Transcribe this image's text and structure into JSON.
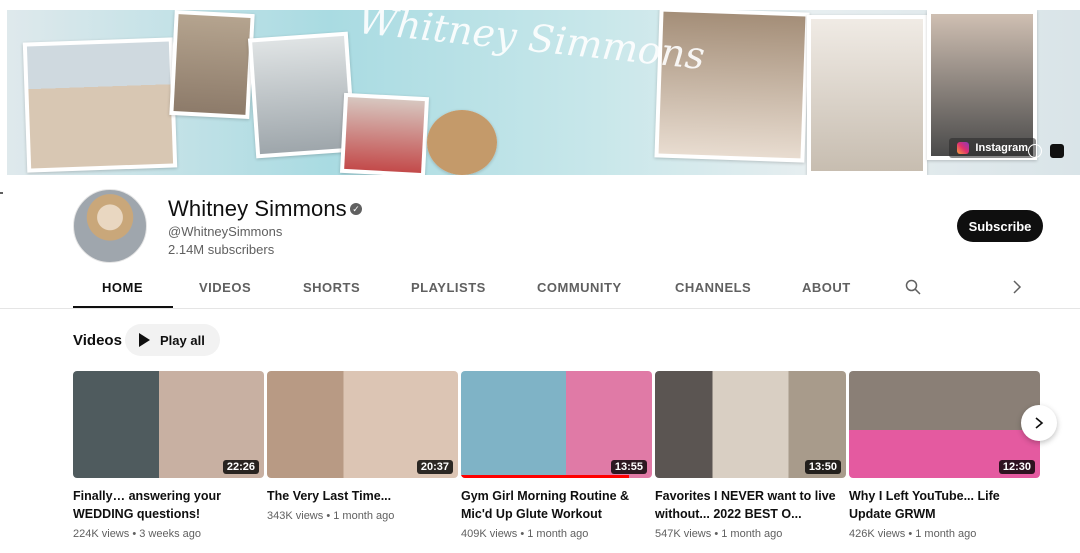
{
  "banner": {
    "script_text": "Whitney Simmons",
    "link_label": "Instagram"
  },
  "channel": {
    "name": "Whitney Simmons",
    "verified_glyph": "✓",
    "handle": "@WhitneySimmons",
    "subscribers": "2.14M subscribers",
    "subscribe_label": "Subscribe"
  },
  "tabs": [
    {
      "label": "HOME",
      "active": true
    },
    {
      "label": "VIDEOS"
    },
    {
      "label": "SHORTS"
    },
    {
      "label": "PLAYLISTS"
    },
    {
      "label": "COMMUNITY"
    },
    {
      "label": "CHANNELS"
    },
    {
      "label": "ABOUT"
    }
  ],
  "videos_section": {
    "title": "Videos",
    "play_all_label": "Play all"
  },
  "videos": [
    {
      "title": "Finally… answering your WEDDING questions!",
      "duration": "22:26",
      "views": "224K views",
      "age": "3 weeks ago",
      "thumb_color": "#6f8a8c"
    },
    {
      "title": "The Very Last Time...",
      "duration": "20:37",
      "views": "343K views",
      "age": "1 month ago",
      "thumb_color": "#c7a58e"
    },
    {
      "title": "Gym Girl Morning Routine & Mic'd Up Glute Workout",
      "duration": "13:55",
      "views": "409K views",
      "age": "1 month ago",
      "thumb_color": "#8fc1d3",
      "progress": 0.88
    },
    {
      "title": "Favorites I NEVER want to live without... 2022 BEST O...",
      "duration": "13:50",
      "views": "547K views",
      "age": "1 month ago",
      "thumb_color": "#b8aea0"
    },
    {
      "title": "Why I Left YouTube... Life Update GRWM",
      "duration": "12:30",
      "views": "426K views",
      "age": "1 month ago",
      "thumb_color": "#9a8e82"
    }
  ],
  "icons": {
    "search": "search-icon",
    "chevron": "chevron-right-icon",
    "play": "play-icon"
  },
  "colors": {
    "subscribe_bg": "#0f0f0f",
    "progress": "#ff0000",
    "muted_text": "#606060"
  }
}
